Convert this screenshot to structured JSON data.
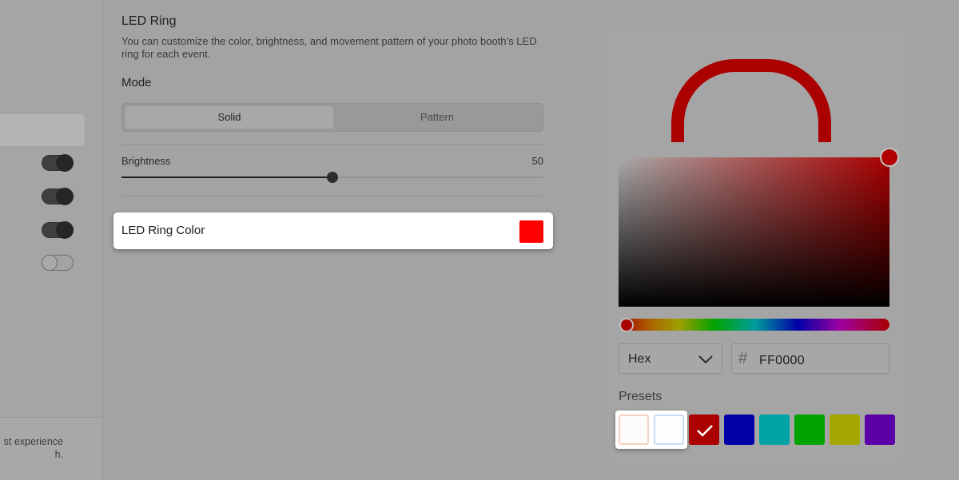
{
  "sidebar": {
    "toggles": [
      {
        "state": "on"
      },
      {
        "state": "on"
      },
      {
        "state": "on"
      },
      {
        "state": "off"
      }
    ],
    "footer_lines": [
      "st experience",
      "h."
    ]
  },
  "section": {
    "title": "LED Ring",
    "description": "You can customize the color, brightness, and movement pattern of your photo booth’s LED ring for each event."
  },
  "mode": {
    "label": "Mode",
    "options": [
      "Solid",
      "Pattern"
    ],
    "selected": "Solid"
  },
  "brightness": {
    "label": "Brightness",
    "value": "50",
    "fraction": 0.5
  },
  "led_color": {
    "label": "LED Ring Color",
    "swatch_color": "#ff0000"
  },
  "picker": {
    "ring_color": "#aa0000",
    "format": "Hex",
    "hash_symbol": "#",
    "hex_value": "FF0000",
    "presets_label": "Presets",
    "presets": [
      {
        "color": "#fdfcfb",
        "border": "#f4d4c0",
        "selected": false
      },
      {
        "color": "#fbfdff",
        "border": "#c7dcf5",
        "selected": false
      },
      {
        "color": "#aa0000",
        "border": "#aa0000",
        "selected": true
      },
      {
        "color": "#0000a6",
        "border": "#0000a6",
        "selected": false
      },
      {
        "color": "#00a3a3",
        "border": "#00a3a3",
        "selected": false
      },
      {
        "color": "#00a300",
        "border": "#00a300",
        "selected": false
      },
      {
        "color": "#a6a600",
        "border": "#a6a600",
        "selected": false
      },
      {
        "color": "#5a00a6",
        "border": "#5a00a6",
        "selected": false
      }
    ]
  }
}
